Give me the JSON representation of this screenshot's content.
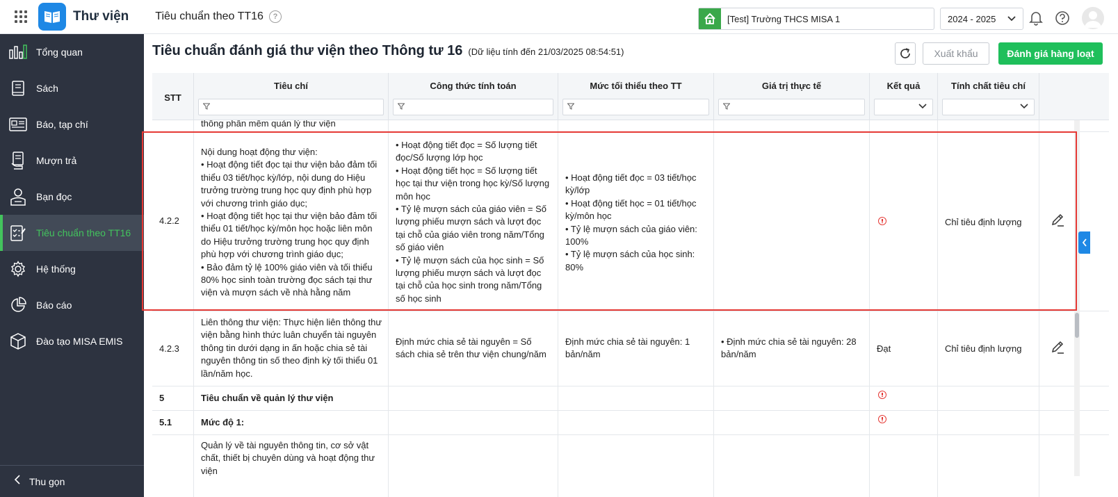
{
  "app": {
    "name": "Thư viện"
  },
  "header": {
    "page_name": "Tiêu chuẩn theo TT16",
    "help_symbol": "?",
    "school": "[Test] Trường THCS MISA 1",
    "school_year": "2024 - 2025"
  },
  "sidebar": {
    "items": [
      {
        "label": "Tổng quan",
        "icon": "dashboard-icon"
      },
      {
        "label": "Sách",
        "icon": "book-icon"
      },
      {
        "label": "Báo, tạp chí",
        "icon": "newspaper-icon"
      },
      {
        "label": "Mượn trả",
        "icon": "borrow-icon"
      },
      {
        "label": "Bạn đọc",
        "icon": "reader-icon"
      },
      {
        "label": "Tiêu chuẩn theo TT16",
        "icon": "checklist-icon",
        "active": true
      },
      {
        "label": "Hệ thống",
        "icon": "gear-icon"
      },
      {
        "label": "Báo cáo",
        "icon": "pie-chart-icon"
      },
      {
        "label": "Đào tạo MISA EMIS",
        "icon": "cube-icon"
      }
    ],
    "collapse_label": "Thu gọn"
  },
  "main": {
    "title": "Tiêu chuẩn đánh giá thư viện theo Thông tư 16",
    "subtitle": "(Dữ liệu tính đến 21/03/2025 08:54:51)",
    "export_label": "Xuất khẩu",
    "evaluate_label": "Đánh giá hàng loạt"
  },
  "table": {
    "columns": [
      "STT",
      "Tiêu chí",
      "Công thức tính toán",
      "Mức tối thiểu theo TT",
      "Giá trị thực tế",
      "Kết quả",
      "Tính chất tiêu chí"
    ],
    "partial_row": {
      "criteria": "thống phần mềm quản lý thư viện"
    },
    "rows": [
      {
        "stt": "4.2.2",
        "criteria": "Nội dung hoạt động thư viện:\n• Hoạt động tiết đọc tại thư viện bảo đảm tối thiểu 03 tiết/học kỳ/lớp, nội dung do Hiệu trưởng trường trung học quy định phù hợp với chương trình giáo dục;\n• Hoạt động tiết học tại thư viện bảo đảm tối thiểu 01 tiết/học kỳ/môn học hoặc liên môn do Hiệu trưởng trường trung học quy định phù hợp với chương trình giáo dục;\n• Bảo đảm tỷ lệ 100% giáo viên và tối thiểu 80% học sinh toàn trường đọc sách tại thư viện và mượn sách về nhà hằng năm",
        "formula": "• Hoạt động tiết đọc = Số lượng tiết đọc/Số lượng lớp học\n• Hoạt động tiết học = Số lượng tiết học tại thư viện trong học kỳ/Số lượng môn học\n• Tỷ lệ mượn sách của giáo viên = Số lượng phiếu mượn sách và lượt đọc tại chỗ của giáo viên trong năm/Tổng số giáo viên\n• Tỷ lệ mượn sách của học sinh = Số lượng phiếu mượn sách và lượt đọc tại chỗ của học sinh trong năm/Tổng số học sinh",
        "minimum": "• Hoạt động tiết đọc = 03 tiết/học kỳ/lớp\n• Hoạt động tiết học = 01 tiết/học kỳ/môn học\n• Tỷ lệ mượn sách của giáo viên: 100%\n• Tỷ lệ mượn sách của học sinh: 80%",
        "actual": "",
        "result": "",
        "result_icon": "warning-icon",
        "nature": "Chỉ tiêu định lượng"
      },
      {
        "stt": "4.2.3",
        "criteria": "Liên thông thư viện: Thực hiện liên thông thư viện bằng hình thức luân chuyển tài nguyên thông tin dưới dạng in ấn hoặc chia sẻ tài nguyên thông tin số theo định kỳ tối thiểu 01 lần/năm học.",
        "formula": "Định mức chia sẻ tài nguyên = Số sách chia sẻ trên thư viện chung/năm",
        "minimum": "Định mức chia sẻ tài nguyên: 1 bản/năm",
        "actual": "• Định mức chia sẻ tài nguyên: 28 bản/năm",
        "result": "Đạt",
        "nature": "Chỉ tiêu định lượng"
      },
      {
        "stt": "5",
        "criteria": "Tiêu chuẩn về quản lý thư viện",
        "result_icon": "warning-icon"
      },
      {
        "stt": "5.1",
        "criteria": "Mức độ 1:",
        "result_icon": "warning-icon"
      },
      {
        "stt": "",
        "criteria": "Quản lý về tài nguyên thông tin, cơ sở vật chất, thiết bị chuyên dùng và hoạt động thư viện"
      }
    ]
  },
  "colors": {
    "accent_green": "#1fbf5b",
    "sidebar_bg": "#2d3340",
    "active_green": "#43c35d",
    "highlight_red": "#e53935",
    "brand_blue": "#1e88e5"
  }
}
